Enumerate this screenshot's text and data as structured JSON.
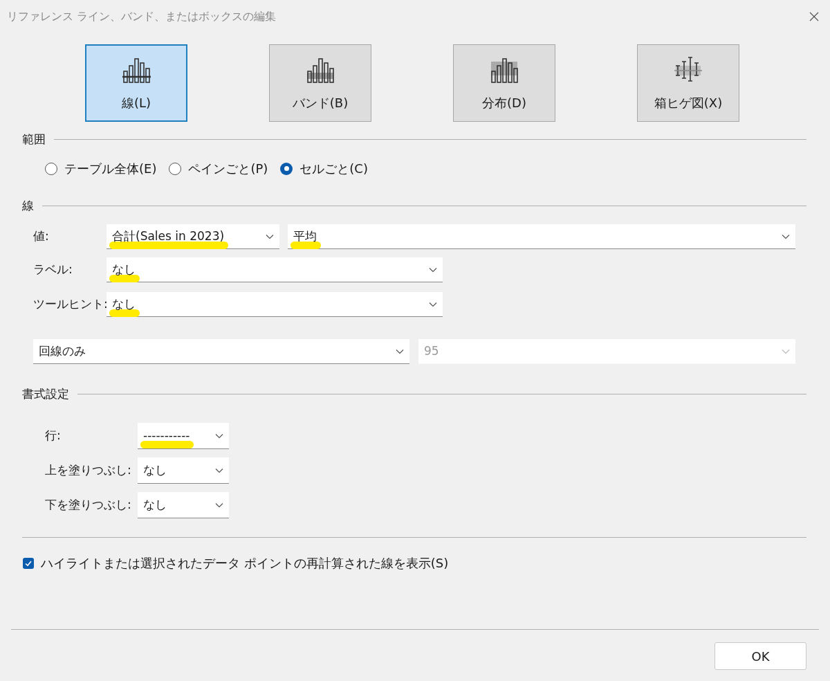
{
  "window": {
    "title": "リファレンス ライン、バンド、またはボックスの編集"
  },
  "types": [
    {
      "kind": "line",
      "label": "線(L)",
      "selected": true
    },
    {
      "kind": "band",
      "label": "バンド(B)",
      "selected": false
    },
    {
      "kind": "distribution",
      "label": "分布(D)",
      "selected": false
    },
    {
      "kind": "boxplot",
      "label": "箱ヒゲ図(X)",
      "selected": false
    }
  ],
  "scope": {
    "heading": "範囲",
    "options": [
      {
        "label": "テーブル全体(E)",
        "selected": false
      },
      {
        "label": "ペインごと(P)",
        "selected": false
      },
      {
        "label": "セルごと(C)",
        "selected": true
      }
    ]
  },
  "line": {
    "heading": "線",
    "value": {
      "label": "値:",
      "field": {
        "value": "合計(Sales in 2023)",
        "highlighted": true
      },
      "aggregation": {
        "value": "平均",
        "highlighted": true
      }
    },
    "label": {
      "label": "ラベル:",
      "value": "なし",
      "highlighted": true
    },
    "tooltip": {
      "label": "ツールヒント:",
      "value": "なし",
      "highlighted": true
    },
    "line_only": {
      "value": "回線のみ"
    },
    "confidence": {
      "value": "95",
      "disabled": true
    }
  },
  "format": {
    "heading": "書式設定",
    "rows": [
      {
        "label": "行:",
        "value": "-----------",
        "highlighted": true
      },
      {
        "label": "上を塗りつぶし:",
        "value": "なし",
        "highlighted": false
      },
      {
        "label": "下を塗りつぶし:",
        "value": "なし",
        "highlighted": false
      }
    ]
  },
  "recalc": {
    "label": "ハイライトまたは選択されたデータ ポイントの再計算された線を表示(S)",
    "checked": true
  },
  "ok_button": "OK"
}
